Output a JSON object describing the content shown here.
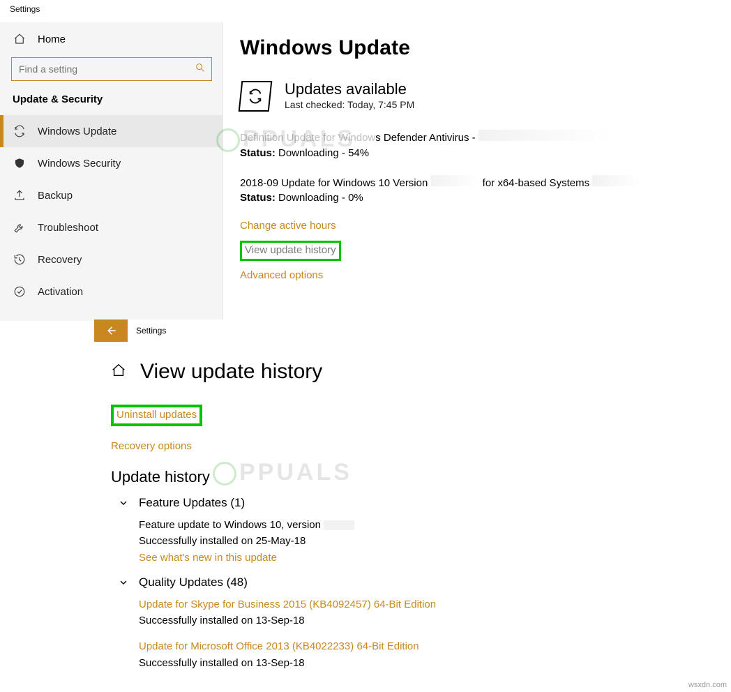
{
  "top": {
    "window_title": "Settings",
    "home_label": "Home",
    "search_placeholder": "Find a setting",
    "section_header": "Update & Security",
    "nav": [
      {
        "label": "Windows Update"
      },
      {
        "label": "Windows Security"
      },
      {
        "label": "Backup"
      },
      {
        "label": "Troubleshoot"
      },
      {
        "label": "Recovery"
      },
      {
        "label": "Activation"
      }
    ],
    "page_title": "Windows Update",
    "status_title": "Updates available",
    "last_checked": "Last checked: Today, 7:45 PM",
    "update1_prefix": "Definition Update for Window",
    "update1_rest": "s Defender Antivirus -",
    "update1_status_label": "Status:",
    "update1_status_value": " Downloading - 54%",
    "update2_line_a": "2018-09 Update for Windows 10 Version",
    "update2_line_b": " for x64-based Systems ",
    "update2_status_label": "Status:",
    "update2_status_value": " Downloading - 0%",
    "link_active_hours": "Change active hours",
    "link_view_history": "View update history",
    "link_advanced": "Advanced options"
  },
  "bottom": {
    "window_title": "Settings",
    "page_title": "View update history",
    "link_uninstall": "Uninstall updates",
    "link_recovery": "Recovery options",
    "section_title": "Update history",
    "feature_header": "Feature Updates (1)",
    "feature_line1": "Feature update to Windows 10, version ",
    "feature_line2": "Successfully installed on 25-May-18",
    "feature_link": "See what's new in this update",
    "quality_header": "Quality Updates (48)",
    "q1_title": "Update for Skype for Business 2015 (KB4092457) 64-Bit Edition",
    "q1_sub": "Successfully installed on 13-Sep-18",
    "q2_title": "Update for Microsoft Office 2013 (KB4022233) 64-Bit Edition",
    "q2_sub": "Successfully installed on 13-Sep-18"
  },
  "watermark_text": "PPUALS",
  "corner_credit": "wsxdn.com"
}
